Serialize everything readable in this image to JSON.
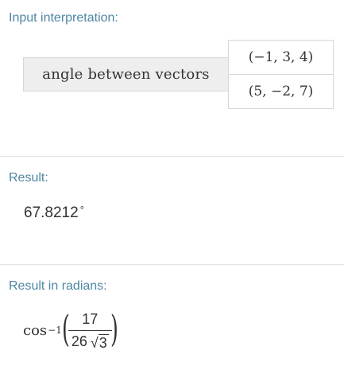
{
  "input_pod": {
    "title": "Input interpretation:",
    "label": "angle between vectors",
    "vector_1": "(−1, 3, 4)",
    "vector_2": "(5, −2, 7)"
  },
  "result_pod": {
    "title": "Result:",
    "value": "67.8212",
    "unit_symbol": "°"
  },
  "radians_pod": {
    "title": "Result in radians:",
    "function": "cos",
    "exponent": "−1",
    "numerator": "17",
    "denominator_coefficient": "26",
    "radical_symbol": "√",
    "radicand": "3"
  },
  "colors": {
    "pod_title": "#4e87a3",
    "divider": "#e3e3e3",
    "label_background": "#eeeeee",
    "text": "#333333"
  }
}
